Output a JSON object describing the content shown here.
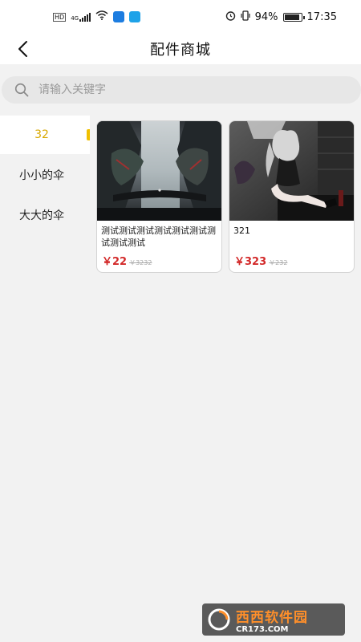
{
  "status_bar": {
    "badge": "HD",
    "network": "4G",
    "battery": "94%",
    "battery_level": 0.94,
    "time": "17:35"
  },
  "header": {
    "title": "配件商城",
    "back_icon": "chevron-left-icon"
  },
  "search": {
    "placeholder": "请输入关键字",
    "value": "",
    "icon": "search-icon"
  },
  "sidebar": {
    "items": [
      {
        "label": "32",
        "active": true
      },
      {
        "label": "小小的伞",
        "active": false
      },
      {
        "label": "大大的伞",
        "active": false
      }
    ]
  },
  "products": [
    {
      "name": "测试测试测试测试测试测试测试测试测试",
      "price": "￥22",
      "old_price": "￥3232"
    },
    {
      "name": "321",
      "price": "￥323",
      "old_price": "￥232"
    }
  ],
  "watermark": {
    "text": "西西软件园",
    "site": "CR173.COM"
  },
  "colors": {
    "accent": "#f0c000",
    "active_text": "#d8a800",
    "price": "#d32a2a",
    "background": "#f2f2f2"
  }
}
